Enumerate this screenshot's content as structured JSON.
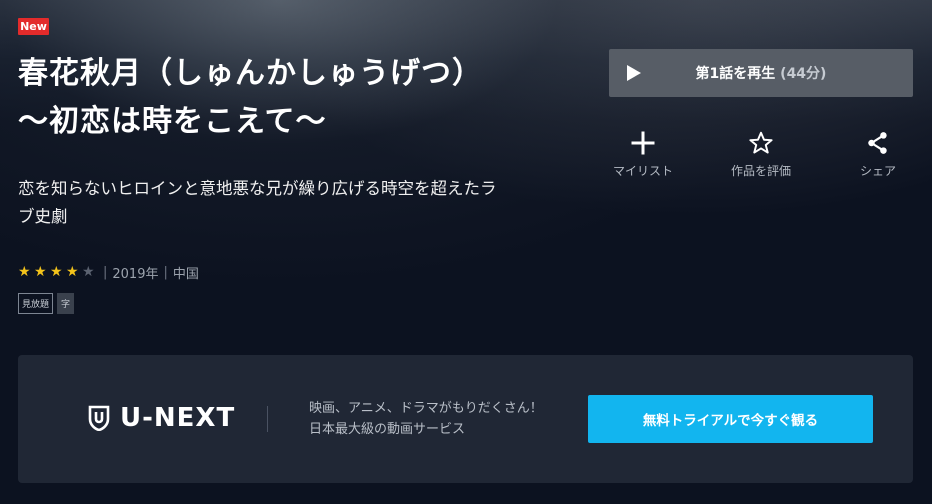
{
  "badge": {
    "label": "New",
    "color": "#e32b2b"
  },
  "title": "春花秋月（しゅんかしゅうげつ）　～初恋は時をこえて～",
  "description": "恋を知らないヒロインと意地悪な兄が繰り広げる時空を超えたラブ史劇",
  "rating": {
    "value": 4,
    "max": 5
  },
  "meta": {
    "year": "2019年",
    "country": "中国",
    "separator": "|"
  },
  "tags": [
    "見放題",
    "字"
  ],
  "play_button": {
    "label": "第1話を再生",
    "duration": "(44分)",
    "icon": "play-icon"
  },
  "actions": [
    {
      "label": "マイリスト",
      "icon": "plus-icon"
    },
    {
      "label": "作品を評価",
      "icon": "star-outline-icon"
    },
    {
      "label": "シェア",
      "icon": "share-icon"
    }
  ],
  "promo": {
    "logo_text": "U-NEXT",
    "line1": "映画、アニメ、ドラマがもりだくさん！",
    "line2": "日本最大級の動画サービス",
    "cta": "無料トライアルで今すぐ観る",
    "accent_color": "#12b5ef"
  },
  "colors": {
    "background": "#0c1220",
    "star_on": "#f3c31b",
    "star_off": "#5b6270"
  }
}
